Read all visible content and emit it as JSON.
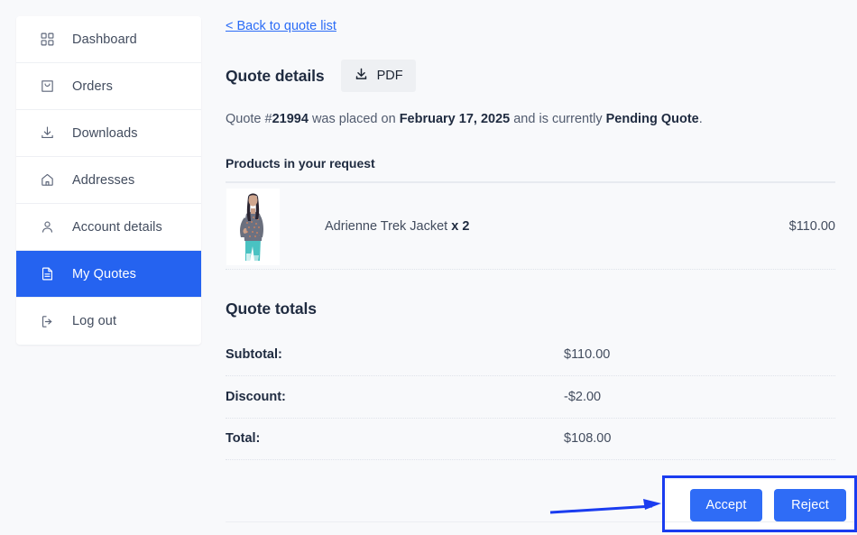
{
  "theme": {
    "accent": "#2563f0",
    "button_blue": "#2f6cf6",
    "link_blue": "#2b6cf6",
    "annotation_blue": "#1a3cf0",
    "page_bg": "#f8f9fb",
    "card_bg": "#ffffff",
    "text_dark": "#1f2b40",
    "text_muted": "#515b6e"
  },
  "sidebar": {
    "items": [
      {
        "label": "Dashboard",
        "icon": "grid-icon",
        "active": false
      },
      {
        "label": "Orders",
        "icon": "bag-icon",
        "active": false
      },
      {
        "label": "Downloads",
        "icon": "download-icon",
        "active": false
      },
      {
        "label": "Addresses",
        "icon": "home-icon",
        "active": false
      },
      {
        "label": "Account details",
        "icon": "user-icon",
        "active": false
      },
      {
        "label": "My Quotes",
        "icon": "document-icon",
        "active": true
      },
      {
        "label": "Log out",
        "icon": "logout-icon",
        "active": false
      }
    ]
  },
  "main": {
    "back_link": "< Back to quote list",
    "details_title": "Quote details",
    "pdf_button": {
      "label": "PDF",
      "icon": "download-icon"
    },
    "status": {
      "prefix": "Quote #",
      "quote_number": "21994",
      "middle": " was placed on ",
      "date": "February 17, 2025",
      "middle2": " and is currently ",
      "state": "Pending Quote",
      "suffix": "."
    },
    "products_heading": "Products in your request",
    "products": [
      {
        "name": "Adrienne Trek Jacket",
        "quantity_label": "x 2",
        "price": "$110.00",
        "thumb_alt": "Adrienne Trek Jacket product photo"
      }
    ],
    "totals_heading": "Quote totals",
    "totals": [
      {
        "label": "Subtotal:",
        "value": "$110.00"
      },
      {
        "label": "Discount:",
        "value": "-$2.00"
      },
      {
        "label": "Total:",
        "value": "$108.00"
      }
    ],
    "actions": [
      {
        "label": "Accept",
        "name": "accept-button"
      },
      {
        "label": "Reject",
        "name": "reject-button"
      }
    ]
  },
  "annotation": {
    "highlight_target": "quote-action-buttons",
    "arrow_direction": "right"
  }
}
